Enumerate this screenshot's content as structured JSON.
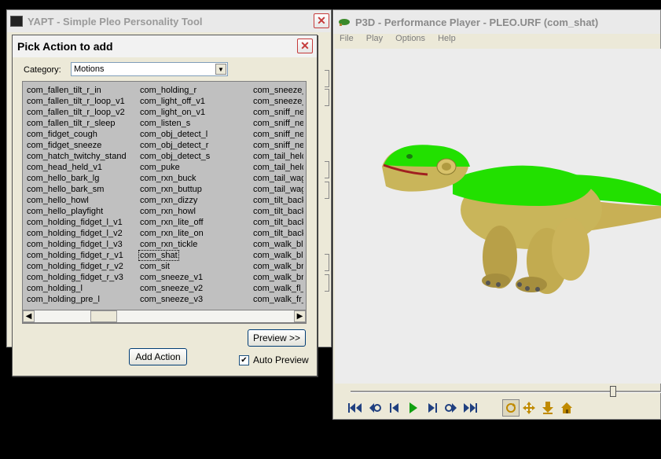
{
  "yapt": {
    "title": "YAPT - Simple Pleo Personality Tool",
    "close": "✕"
  },
  "dialog": {
    "title": "Pick Action to add",
    "close": "✕",
    "category_label": "Category:",
    "category_value": "Motions",
    "columns": [
      [
        "com_fallen_tilt_r_in",
        "com_fallen_tilt_r_loop_v1",
        "com_fallen_tilt_r_loop_v2",
        "com_fallen_tilt_r_sleep",
        "com_fidget_cough",
        "com_fidget_sneeze",
        "com_hatch_twitchy_stand",
        "com_head_held_v1",
        "com_hello_bark_lg",
        "com_hello_bark_sm",
        "com_hello_howl",
        "com_hello_playfight",
        "com_holding_fidget_l_v1",
        "com_holding_fidget_l_v2",
        "com_holding_fidget_l_v3",
        "com_holding_fidget_r_v1",
        "com_holding_fidget_r_v2",
        "com_holding_fidget_r_v3",
        "com_holding_l",
        "com_holding_pre_l"
      ],
      [
        "com_holding_r",
        "com_light_off_v1",
        "com_light_on_v1",
        "com_listen_s",
        "com_obj_detect_l",
        "com_obj_detect_r",
        "com_obj_detect_s",
        "com_puke",
        "com_rxn_buck",
        "com_rxn_buttup",
        "com_rxn_dizzy",
        "com_rxn_howl",
        "com_rxn_lite_off",
        "com_rxn_lite_on",
        "com_rxn_tickle",
        "com_shat",
        "com_sit",
        "com_sneeze_v1",
        "com_sneeze_v2",
        "com_sneeze_v3"
      ],
      [
        "com_sneeze_v",
        "com_sneeze_v",
        "com_sniff_neu",
        "com_sniff_neu",
        "com_sniff_neu",
        "com_sniff_neu",
        "com_tail_held",
        "com_tail_held",
        "com_tail_wag",
        "com_tail_wag",
        "com_tilt_back",
        "com_tilt_back",
        "com_tilt_back",
        "com_tilt_back",
        "com_walk_bl",
        "com_walk_bl",
        "com_walk_br",
        "com_walk_br",
        "com_walk_fl_v",
        "com_walk_fr_v"
      ]
    ],
    "selected_item": "com_shat",
    "preview_button": "Preview >>",
    "add_button": "Add Action",
    "auto_preview_label": "Auto Preview",
    "auto_preview_checked": true
  },
  "player": {
    "title": "P3D - Performance Player - PLEO.URF (com_shat)",
    "menu": [
      "File",
      "Play",
      "Options",
      "Help"
    ],
    "slider_position": 0.84
  }
}
